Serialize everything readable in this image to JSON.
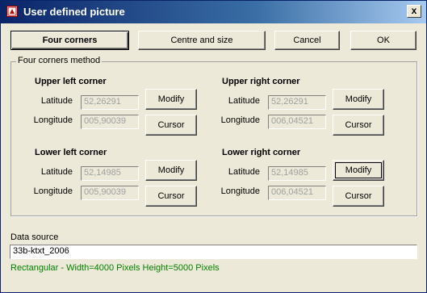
{
  "window": {
    "title": "User defined picture",
    "close_label": "x"
  },
  "toolbar": {
    "four_corners": "Four corners",
    "centre_size": "Centre and size",
    "cancel": "Cancel",
    "ok": "OK"
  },
  "group": {
    "label": "Four corners method"
  },
  "upper_left": {
    "title": "Upper left corner",
    "lat_label": "Latitude",
    "lon_label": "Longitude",
    "lat": "52,26291",
    "lon": "005,90039",
    "modify": "Modify",
    "cursor": "Cursor"
  },
  "upper_right": {
    "title": "Upper right corner",
    "lat_label": "Latitude",
    "lon_label": "Longitude",
    "lat": "52,26291",
    "lon": "006,04521",
    "modify": "Modify",
    "cursor": "Cursor"
  },
  "lower_left": {
    "title": "Lower left corner",
    "lat_label": "Latitude",
    "lon_label": "Longitude",
    "lat": "52,14985",
    "lon": "005,90039",
    "modify": "Modify",
    "cursor": "Cursor"
  },
  "lower_right": {
    "title": "Lower right corner",
    "lat_label": "Latitude",
    "lon_label": "Longitude",
    "lat": "52,14985",
    "lon": "006,04521",
    "modify": "Modify",
    "cursor": "Cursor"
  },
  "data_source": {
    "label": "Data source",
    "value": "33b-ktxt_2006"
  },
  "status": "Rectangular - Width=4000 Pixels  Height=5000 Pixels"
}
